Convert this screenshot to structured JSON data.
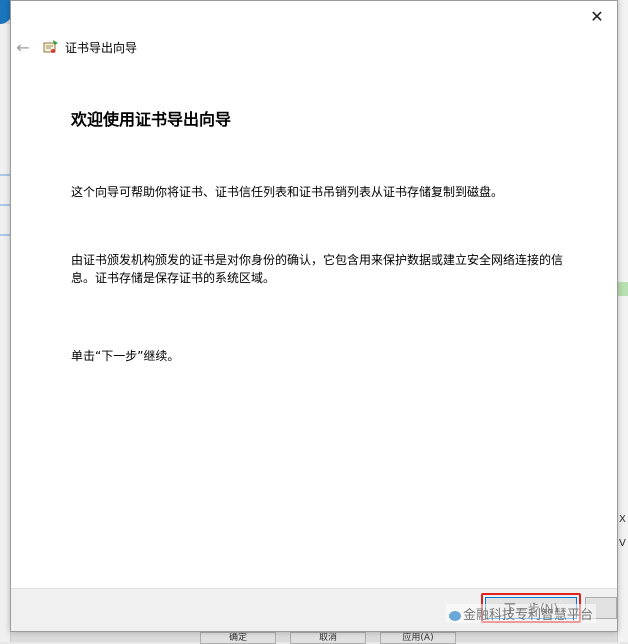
{
  "dialog": {
    "window_title": "证书导出向导",
    "close_glyph": "✕",
    "back_glyph": "←",
    "heading": "欢迎使用证书导出向导",
    "paragraph1": "这个向导可帮助你将证书、证书信任列表和证书吊销列表从证书存储复制到磁盘。",
    "paragraph2": "由证书颁发机构颁发的证书是对你身份的确认，它包含用来保护数据或建立安全网络连接的信息。证书存储是保存证书的系统区域。",
    "paragraph3": "单击“下一步”继续。",
    "next_button_label": "下一步(N)",
    "highlight_color": "#e0221e"
  },
  "watermark": {
    "text": "金融科技专利智慧平台"
  },
  "background": {
    "buttons": [
      "确定",
      "取消",
      "应用(A)"
    ],
    "right_marks": [
      "X",
      "V"
    ]
  },
  "colors": {
    "accent": "#0078d7",
    "background_window": "#dcdcdc"
  }
}
